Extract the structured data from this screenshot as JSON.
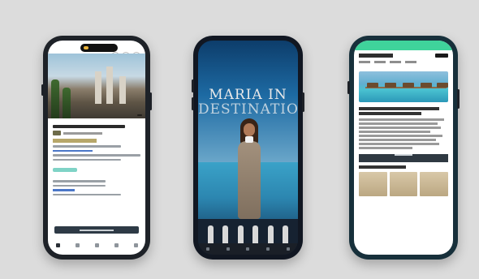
{
  "colors": {
    "background": "#dcdcdc",
    "phone_frame": "#2a2f36",
    "accent_green": "#3fd39b",
    "link_blue": "#4b77c8",
    "tag_gold": "#b7a76a"
  },
  "phones": [
    {
      "name": "hotel-listing-app",
      "icons": [
        "share-icon",
        "heart-icon",
        "close-icon"
      ],
      "tabs": [
        "home-icon",
        "search-icon",
        "trips-icon",
        "inbox-icon",
        "profile-icon"
      ]
    },
    {
      "name": "story-post",
      "title_line1": "MARIA IN",
      "title_line2": "DESTINATION"
    },
    {
      "name": "travel-article-site",
      "icons": [
        "menu-icon"
      ]
    }
  ]
}
